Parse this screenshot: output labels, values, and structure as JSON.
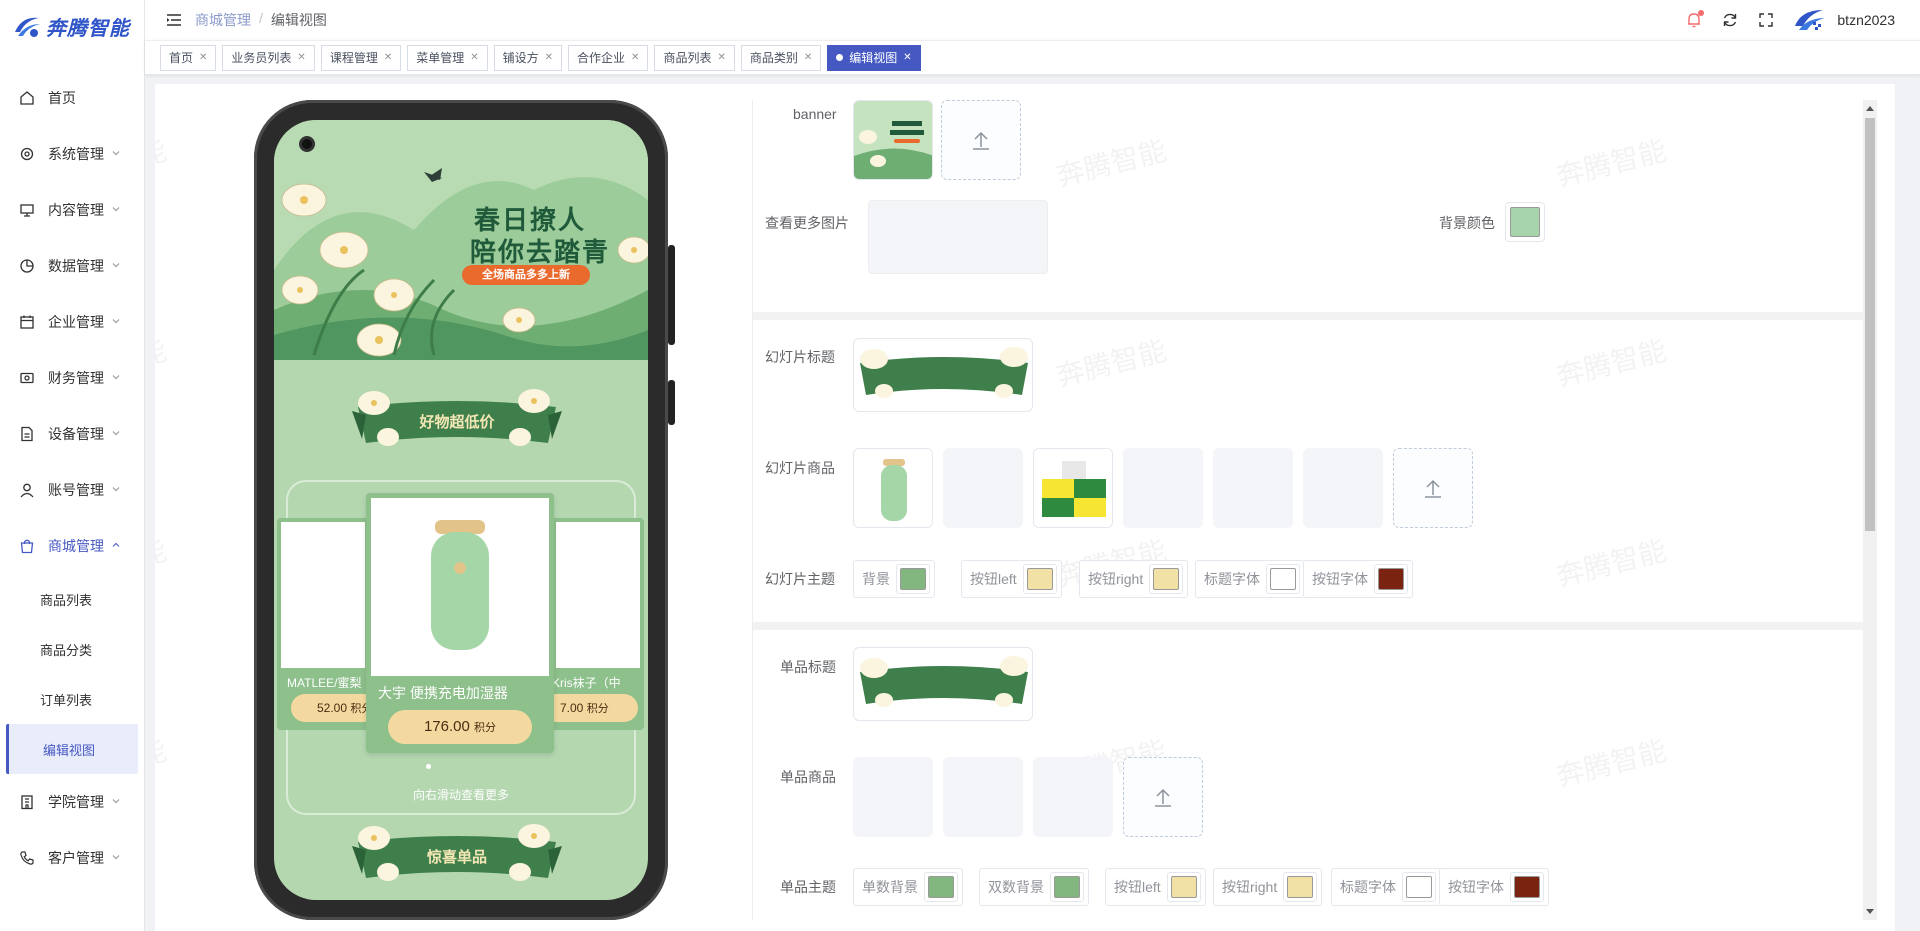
{
  "app": {
    "logo_text": "奔腾智能",
    "watermark": "奔腾智能"
  },
  "colors": {
    "accent": "#4659c3",
    "green": "#8ec08c",
    "banner_bg": "#b4d7b0",
    "cream": "#f3e7b5",
    "brown": "#7a2310"
  },
  "sidebar": {
    "items": [
      {
        "label": "首页",
        "icon": "home-icon"
      },
      {
        "label": "系统管理",
        "icon": "gear-icon"
      },
      {
        "label": "内容管理",
        "icon": "monitor-icon"
      },
      {
        "label": "数据管理",
        "icon": "pie-chart-icon"
      },
      {
        "label": "企业管理",
        "icon": "calendar-icon"
      },
      {
        "label": "财务管理",
        "icon": "wallet-icon"
      },
      {
        "label": "设备管理",
        "icon": "document-icon"
      },
      {
        "label": "账号管理",
        "icon": "user-icon"
      },
      {
        "label": "商城管理",
        "icon": "shopping-bag-icon"
      },
      {
        "label": "学院管理",
        "icon": "building-icon"
      },
      {
        "label": "客户管理",
        "icon": "phone-icon"
      }
    ],
    "submenu": [
      {
        "label": "商品列表"
      },
      {
        "label": "商品分类"
      },
      {
        "label": "订单列表"
      },
      {
        "label": "编辑视图"
      }
    ]
  },
  "header": {
    "breadcrumb": [
      "商城管理",
      "编辑视图"
    ],
    "username": "btzn2023"
  },
  "tabs": [
    {
      "label": "首页"
    },
    {
      "label": "业务员列表"
    },
    {
      "label": "课程管理"
    },
    {
      "label": "菜单管理"
    },
    {
      "label": "铺设方"
    },
    {
      "label": "合作企业"
    },
    {
      "label": "商品列表"
    },
    {
      "label": "商品类别"
    },
    {
      "label": "编辑视图"
    }
  ],
  "preview": {
    "banner_line1": "春日撩人",
    "banner_line2": "陪你去踏青",
    "banner_tag": "全场商品多多上新",
    "ribbon1": "好物超低价",
    "ribbon2": "惊喜单品",
    "left_card": {
      "name": "MATLEE/蜜梨",
      "price": "52.00",
      "unit": "积分"
    },
    "main_card": {
      "name": "大宇 便携充电加湿器",
      "price": "176.00",
      "unit": "积分"
    },
    "right_card": {
      "name": "Kris袜子（中",
      "price": ".00",
      "unit": "积分",
      "price_prefix": "7"
    },
    "more_hint": "向右滑动查看更多"
  },
  "editor": {
    "banner_label": "banner",
    "more_images_label": "查看更多图片",
    "bg_color_label": "背景颜色",
    "bg_color": "#a8d4ab",
    "slide_title_label": "幻灯片标题",
    "slide_goods_label": "幻灯片商品",
    "slide_theme_label": "幻灯片主题",
    "slide_theme": [
      {
        "label": "背景",
        "color": "#82b87f"
      },
      {
        "label": "按钮left",
        "color": "#f1e1a5"
      },
      {
        "label": "按钮right",
        "color": "#f1e1a5"
      },
      {
        "label": "标题字体",
        "color": "#ffffff"
      },
      {
        "label": "按钮字体",
        "color": "#7a2310"
      }
    ],
    "single_title_label": "单品标题",
    "single_goods_label": "单品商品",
    "single_theme_label": "单品主题",
    "single_theme": [
      {
        "label": "单数背景",
        "color": "#82b87f"
      },
      {
        "label": "双数背景",
        "color": "#82b87f"
      },
      {
        "label": "按钮left",
        "color": "#f1e1a5"
      },
      {
        "label": "按钮right",
        "color": "#f1e1a5"
      },
      {
        "label": "标题字体",
        "color": "#ffffff"
      },
      {
        "label": "按钮字体",
        "color": "#7a2310"
      }
    ]
  }
}
